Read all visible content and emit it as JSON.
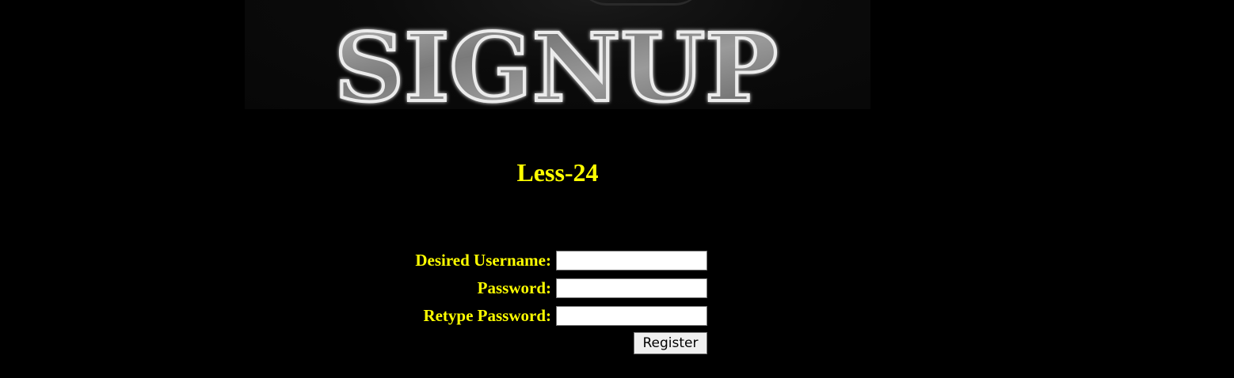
{
  "banner": {
    "logo_text": "SIGNUP",
    "background_color": "#080808",
    "letter_color": "#8c8c8c",
    "letter_outline_color": "#e8e8e8"
  },
  "title": "Less-24",
  "title_color": "#ffff00",
  "form": {
    "username_label": "Desired Username:",
    "username_value": "",
    "password_label": "Password:",
    "password_value": "",
    "retype_label": "Retype Password:",
    "retype_value": "",
    "register_label": "Register"
  },
  "colors": {
    "page_background": "#000000",
    "label_color": "#ffff00"
  }
}
